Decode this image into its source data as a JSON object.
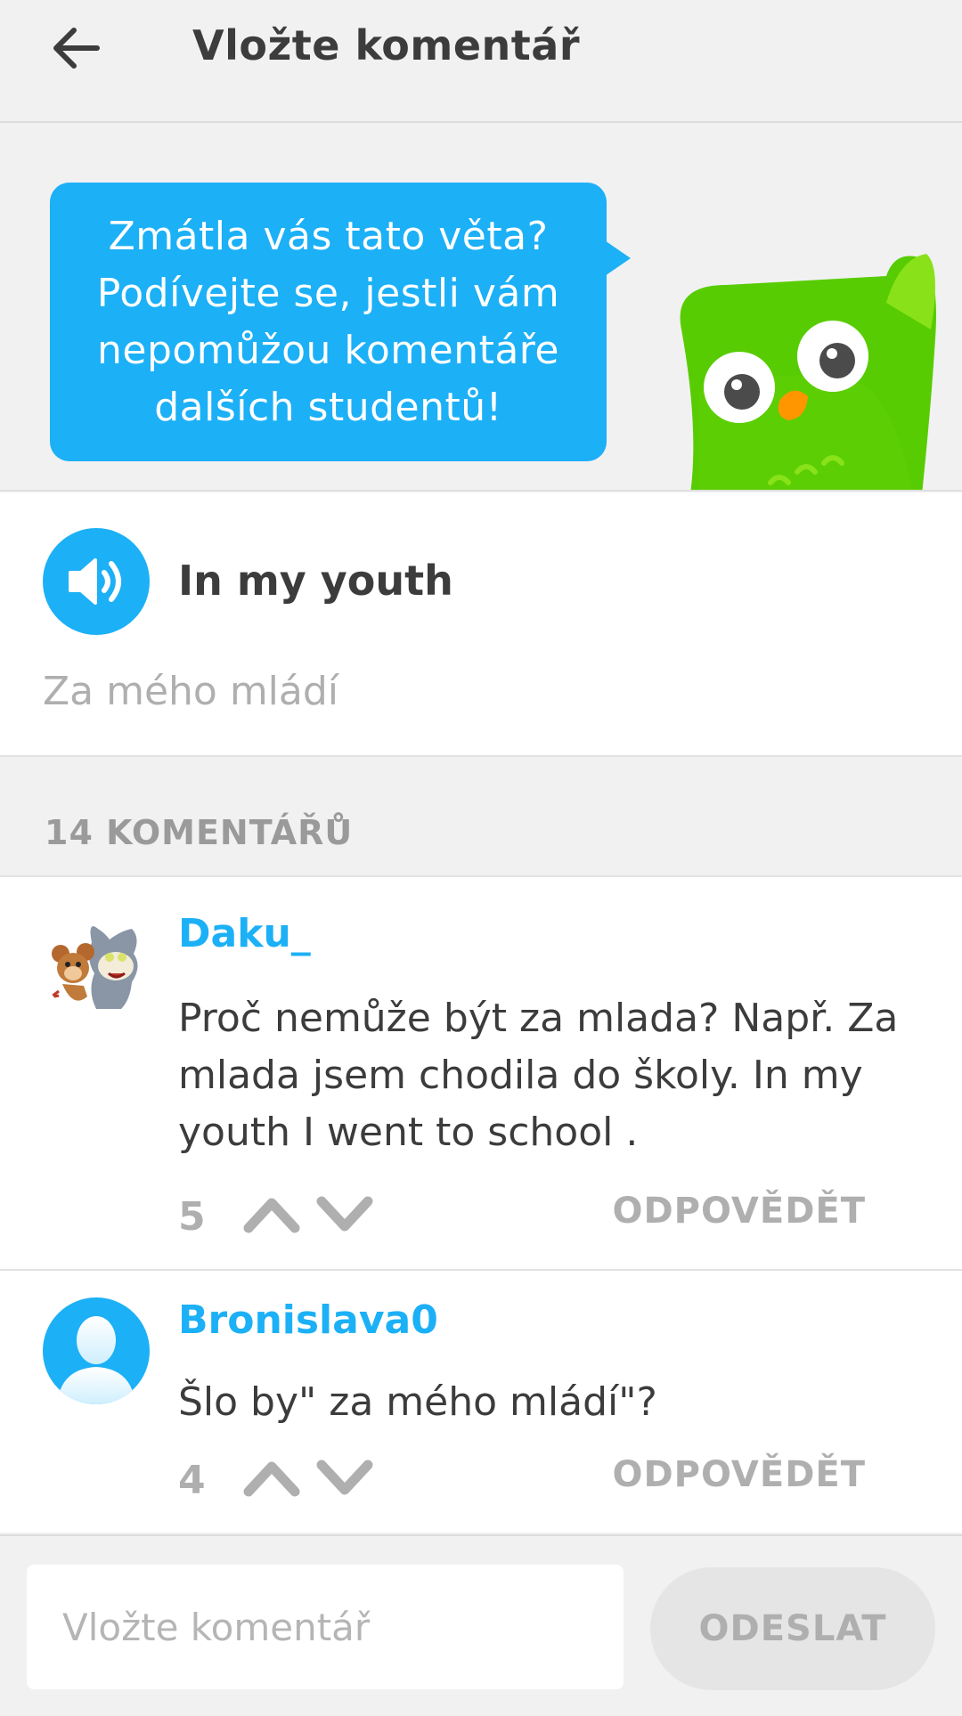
{
  "header": {
    "title": "Vložte komentář",
    "back_icon": "arrow-left-icon"
  },
  "hero": {
    "bubble_text": "Zmátla vás tato věta? Podívejte se, jestli vám nepomůžou komentáře dalších studentů!",
    "mascot": "owl-mascot"
  },
  "sentence": {
    "text": "In my youth",
    "translation": "Za mého mládí",
    "speaker_icon": "speaker-icon"
  },
  "comments": {
    "count_label": "14 KOMENTÁŘŮ",
    "items": [
      {
        "author": "Daku_",
        "body": "Proč nemůže být za mlada? Např. Za mlada jsem chodila do školy. In my youth I went to school .",
        "votes": "5",
        "reply_label": "ODPOVĚDĚT",
        "avatar": "cartoon-avatar"
      },
      {
        "author": "Bronislava0",
        "body": "Šlo by\" za mého mládí\"?",
        "votes": "4",
        "reply_label": "ODPOVĚDĚT",
        "avatar": "default-user-avatar"
      }
    ]
  },
  "footer": {
    "input_placeholder": "Vložte komentář",
    "input_value": "",
    "send_label": "ODESLAT"
  },
  "colors": {
    "accent": "#1cb0f6",
    "owl_green": "#58cc02",
    "muted": "#afafaf",
    "text": "#3c3c3c",
    "background": "#f1f1f2"
  }
}
